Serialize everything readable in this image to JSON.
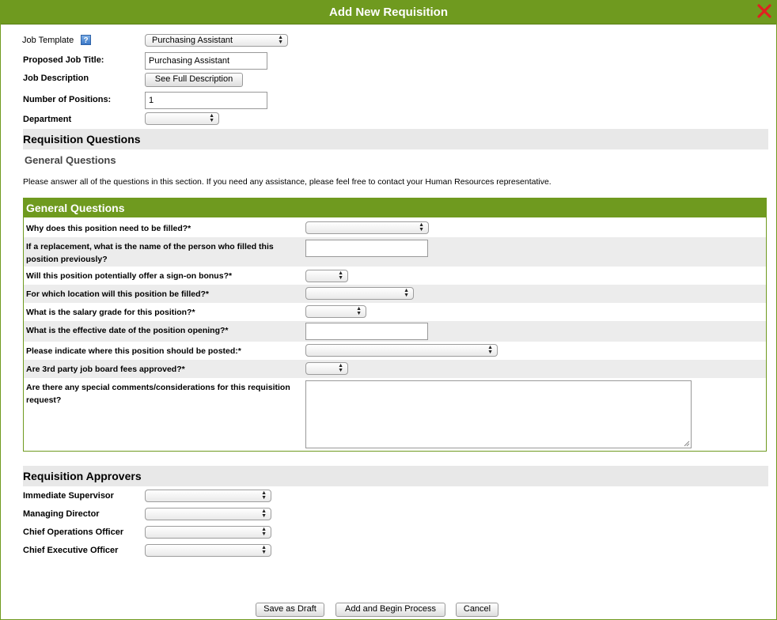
{
  "dialog": {
    "title": "Add New Requisition"
  },
  "form": {
    "job_template_label": "Job Template",
    "job_template_value": "Purchasing Assistant",
    "help_glyph": "?",
    "proposed_title_label": "Proposed Job Title:",
    "proposed_title_value": "Purchasing Assistant",
    "job_description_label": "Job Description",
    "see_full_description": "See Full Description",
    "positions_label": "Number of Positions:",
    "positions_value": "1",
    "department_label": "Department",
    "department_value": ""
  },
  "requisition_questions": {
    "heading": "Requisition Questions",
    "subheading": "General Questions",
    "note": "Please answer all of the questions in this section. If you need any assistance, please feel free to contact your Human Resources representative."
  },
  "general_questions": {
    "heading": "General Questions",
    "questions": [
      {
        "text": "Why does this position need to be filled?*",
        "type": "select",
        "value": ""
      },
      {
        "text": "If a replacement, what is the name of the person who filled this position previously?",
        "type": "text",
        "value": ""
      },
      {
        "text": "Will this position potentially offer a sign-on bonus?*",
        "type": "select",
        "value": ""
      },
      {
        "text": "For which location will this position be filled?*",
        "type": "select",
        "value": ""
      },
      {
        "text": "What is the salary grade for this position?*",
        "type": "select",
        "value": ""
      },
      {
        "text": "What is the effective date of the position opening?*",
        "type": "text",
        "value": ""
      },
      {
        "text": "Please indicate where this position should be posted:*",
        "type": "select",
        "value": ""
      },
      {
        "text": "Are 3rd party job board fees approved?*",
        "type": "select",
        "value": ""
      },
      {
        "text": "Are there any special comments/considerations for this requisition request?",
        "type": "textarea",
        "value": ""
      }
    ]
  },
  "approvers": {
    "heading": "Requisition Approvers",
    "items": [
      {
        "label": "Immediate Supervisor",
        "value": ""
      },
      {
        "label": "Managing Director",
        "value": ""
      },
      {
        "label": "Chief Operations Officer",
        "value": ""
      },
      {
        "label": "Chief Executive Officer",
        "value": ""
      }
    ]
  },
  "footer": {
    "save_draft": "Save as Draft",
    "add_begin": "Add and Begin Process",
    "cancel": "Cancel"
  },
  "icons": {
    "close": "close-x-icon",
    "help": "help-icon",
    "dropdown": "chevron-updown-icon"
  },
  "colors": {
    "accent_green": "#6f9a1f",
    "close_red": "#e02020",
    "section_gray": "#e8e8e8"
  }
}
